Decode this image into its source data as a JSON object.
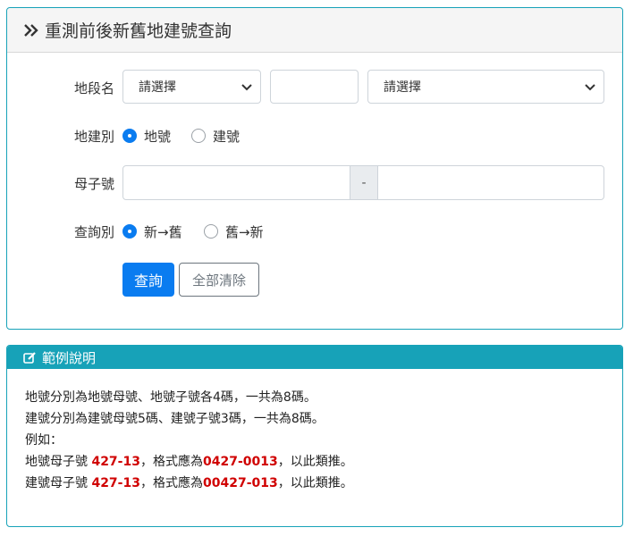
{
  "panel": {
    "title": "重測前後新舊地建號查詢"
  },
  "form": {
    "section": {
      "label": "地段名",
      "select1": "請選擇",
      "input_value": "",
      "select2": "請選擇"
    },
    "type": {
      "label": "地建別",
      "options": [
        "地號",
        "建號"
      ],
      "selected": "地號"
    },
    "number": {
      "label": "母子號",
      "parent_value": "",
      "separator": "-",
      "child_value": ""
    },
    "direction": {
      "label": "查詢別",
      "options": [
        "新→舊",
        "舊→新"
      ],
      "selected": "新→舊"
    },
    "buttons": {
      "query": "查詢",
      "clear": "全部清除"
    }
  },
  "example": {
    "title": "範例說明",
    "line1": "地號分別為地號母號、地號子號各4碼，一共為8碼。",
    "line2": "建號分別為建號母號5碼、建號子號3碼，一共為8碼。",
    "line3": "例如：",
    "line4": {
      "prefix": "地號母子號 ",
      "value": "427-13",
      "middle": "，格式應為",
      "formatted": "0427-0013",
      "suffix": "，以此類推。"
    },
    "line5": {
      "prefix": "建號母子號 ",
      "value": "427-13",
      "middle": "，格式應為",
      "formatted": "00427-013",
      "suffix": "，以此類推。"
    }
  },
  "colors": {
    "accent": "#17a2b8",
    "primary": "#0a7cf0",
    "highlight": "#d00000"
  },
  "icons": {
    "header": "double-chevron-right-icon",
    "example": "edit-icon"
  }
}
